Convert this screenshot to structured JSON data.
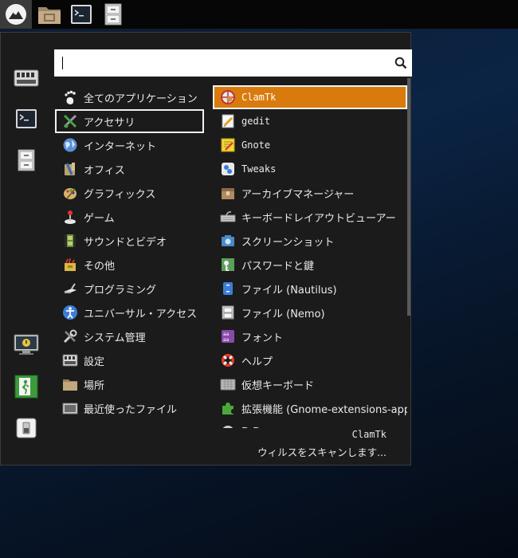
{
  "search": {
    "value": "",
    "placeholder": ""
  },
  "categories": [
    {
      "label": "全てのアプリケーション",
      "icon": "foot-icon"
    },
    {
      "label": "アクセサリ",
      "icon": "accessories-icon",
      "focused": true
    },
    {
      "label": "インターネット",
      "icon": "globe-icon"
    },
    {
      "label": "オフィス",
      "icon": "office-icon"
    },
    {
      "label": "グラフィックス",
      "icon": "graphics-icon"
    },
    {
      "label": "ゲーム",
      "icon": "joystick-icon"
    },
    {
      "label": "サウンドとビデオ",
      "icon": "film-icon"
    },
    {
      "label": "その他",
      "icon": "other-icon"
    },
    {
      "label": "プログラミング",
      "icon": "programming-icon"
    },
    {
      "label": "ユニバーサル・アクセス",
      "icon": "accessibility-icon"
    },
    {
      "label": "システム管理",
      "icon": "tools-icon"
    },
    {
      "label": "設定",
      "icon": "settings-icon"
    },
    {
      "label": "場所",
      "icon": "folder-icon"
    },
    {
      "label": "最近使ったファイル",
      "icon": "recent-files-icon"
    }
  ],
  "apps": [
    {
      "label": "ClamTk",
      "icon": "clamtk-icon",
      "selected": true,
      "mono": true
    },
    {
      "label": "gedit",
      "icon": "gedit-icon",
      "mono": true
    },
    {
      "label": "Gnote",
      "icon": "gnote-icon",
      "mono": true
    },
    {
      "label": "Tweaks",
      "icon": "tweaks-icon",
      "mono": true
    },
    {
      "label": "アーカイブマネージャー",
      "icon": "archive-icon"
    },
    {
      "label": "キーボードレイアウトビューアー",
      "icon": "keyboard-layout-icon"
    },
    {
      "label": "スクリーンショット",
      "icon": "screenshot-icon"
    },
    {
      "label": "パスワードと鍵",
      "icon": "keys-icon"
    },
    {
      "label": "ファイル (Nautilus)",
      "icon": "nautilus-icon"
    },
    {
      "label": "ファイル (Nemo)",
      "icon": "nemo-icon"
    },
    {
      "label": "フォント",
      "icon": "fonts-icon"
    },
    {
      "label": "ヘルプ",
      "icon": "help-icon"
    },
    {
      "label": "仮想キーボード",
      "icon": "virtual-keyboard-icon"
    },
    {
      "label": "拡張機能 (Gnome-extensions-app)",
      "icon": "extensions-icon"
    },
    {
      "label": "D.D..",
      "icon": "partial-app-icon"
    }
  ],
  "description": {
    "name": "ClamTk",
    "text": "ウィルスをスキャンします..."
  },
  "colors": {
    "selected_bg": "#d97a0c",
    "menu_bg": "#1b1b1b",
    "panel_bg": "#060606"
  }
}
